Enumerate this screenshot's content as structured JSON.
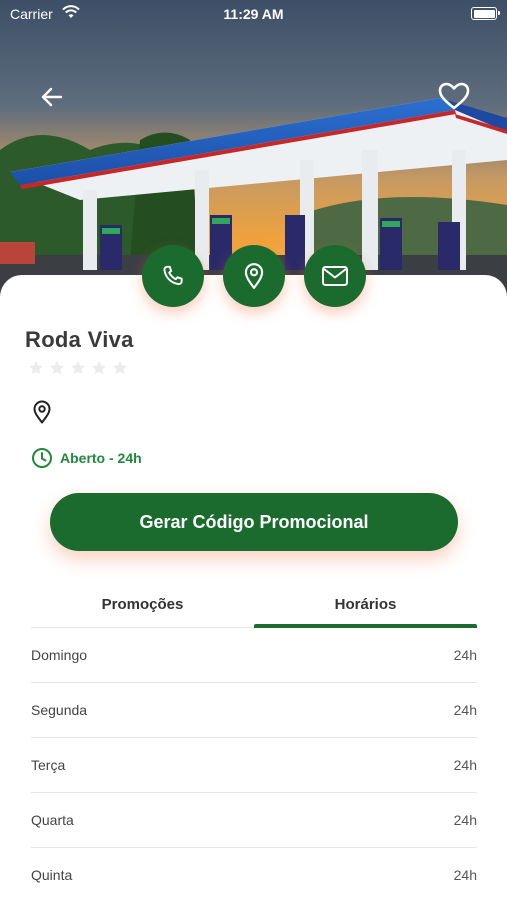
{
  "status_bar": {
    "carrier": "Carrier",
    "time": "11:29 AM"
  },
  "station": {
    "name": "Roda Viva",
    "rating_stars": 0,
    "rating_max": 5,
    "address": "",
    "hours_status": "Aberto - 24h"
  },
  "actions": {
    "phone_icon": "phone-icon",
    "location_icon": "map-pin-icon",
    "email_icon": "mail-icon"
  },
  "promo_button_label": "Gerar Código Promocional",
  "tabs": [
    {
      "label": "Promoções",
      "active": false
    },
    {
      "label": "Horários",
      "active": true
    }
  ],
  "schedule": [
    {
      "day": "Domingo",
      "hours": "24h"
    },
    {
      "day": "Segunda",
      "hours": "24h"
    },
    {
      "day": "Terça",
      "hours": "24h"
    },
    {
      "day": "Quarta",
      "hours": "24h"
    },
    {
      "day": "Quinta",
      "hours": "24h"
    }
  ],
  "colors": {
    "primary": "#1b6b2e",
    "accent_text": "#1f8a3a",
    "shadow": "#f06e3c"
  }
}
